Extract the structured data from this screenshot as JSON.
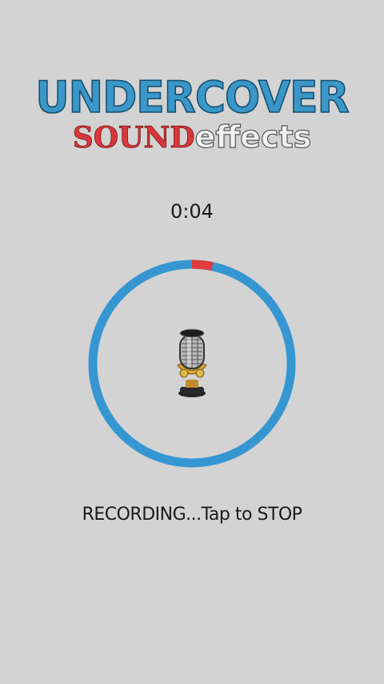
{
  "logo": {
    "line1": "UNDERCOVER",
    "line2_a": "SOUND",
    "line2_b": "effects"
  },
  "timer": "0:04",
  "recorder": {
    "progress_fraction": 0.033,
    "ring_color": "#3596d2",
    "progress_color": "#e03a3e",
    "mic_icon": "microphone-icon"
  },
  "status_text": "RECORDING...Tap to STOP"
}
